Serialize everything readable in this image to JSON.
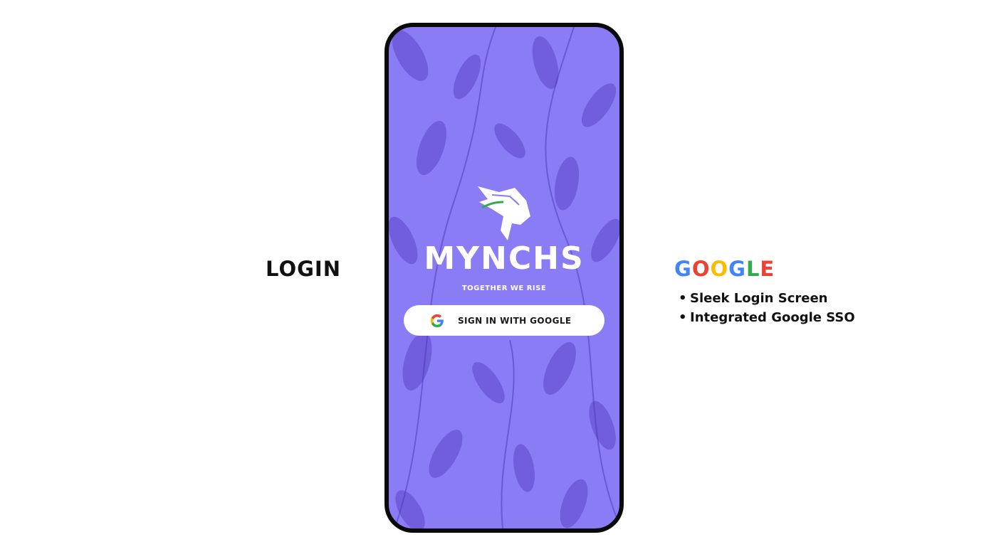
{
  "left_title": "LOGIN",
  "phone": {
    "app_name": "MYNCHS",
    "tagline": "TOGETHER WE RISE",
    "signin_button_label": "SIGN IN WITH GOOGLE",
    "logo_icon": "lion-head-icon",
    "button_icon": "google-g-icon",
    "background_color": "#8a7cf5",
    "pattern_color": "#5b46c9"
  },
  "google_heading": {
    "letters": [
      "G",
      "O",
      "O",
      "G",
      "L",
      "E"
    ],
    "colors": [
      "#4285F4",
      "#EA4335",
      "#FBBC05",
      "#4285F4",
      "#34A853",
      "#EA4335"
    ]
  },
  "features": [
    "Sleek Login Screen",
    "Integrated Google SSO"
  ]
}
